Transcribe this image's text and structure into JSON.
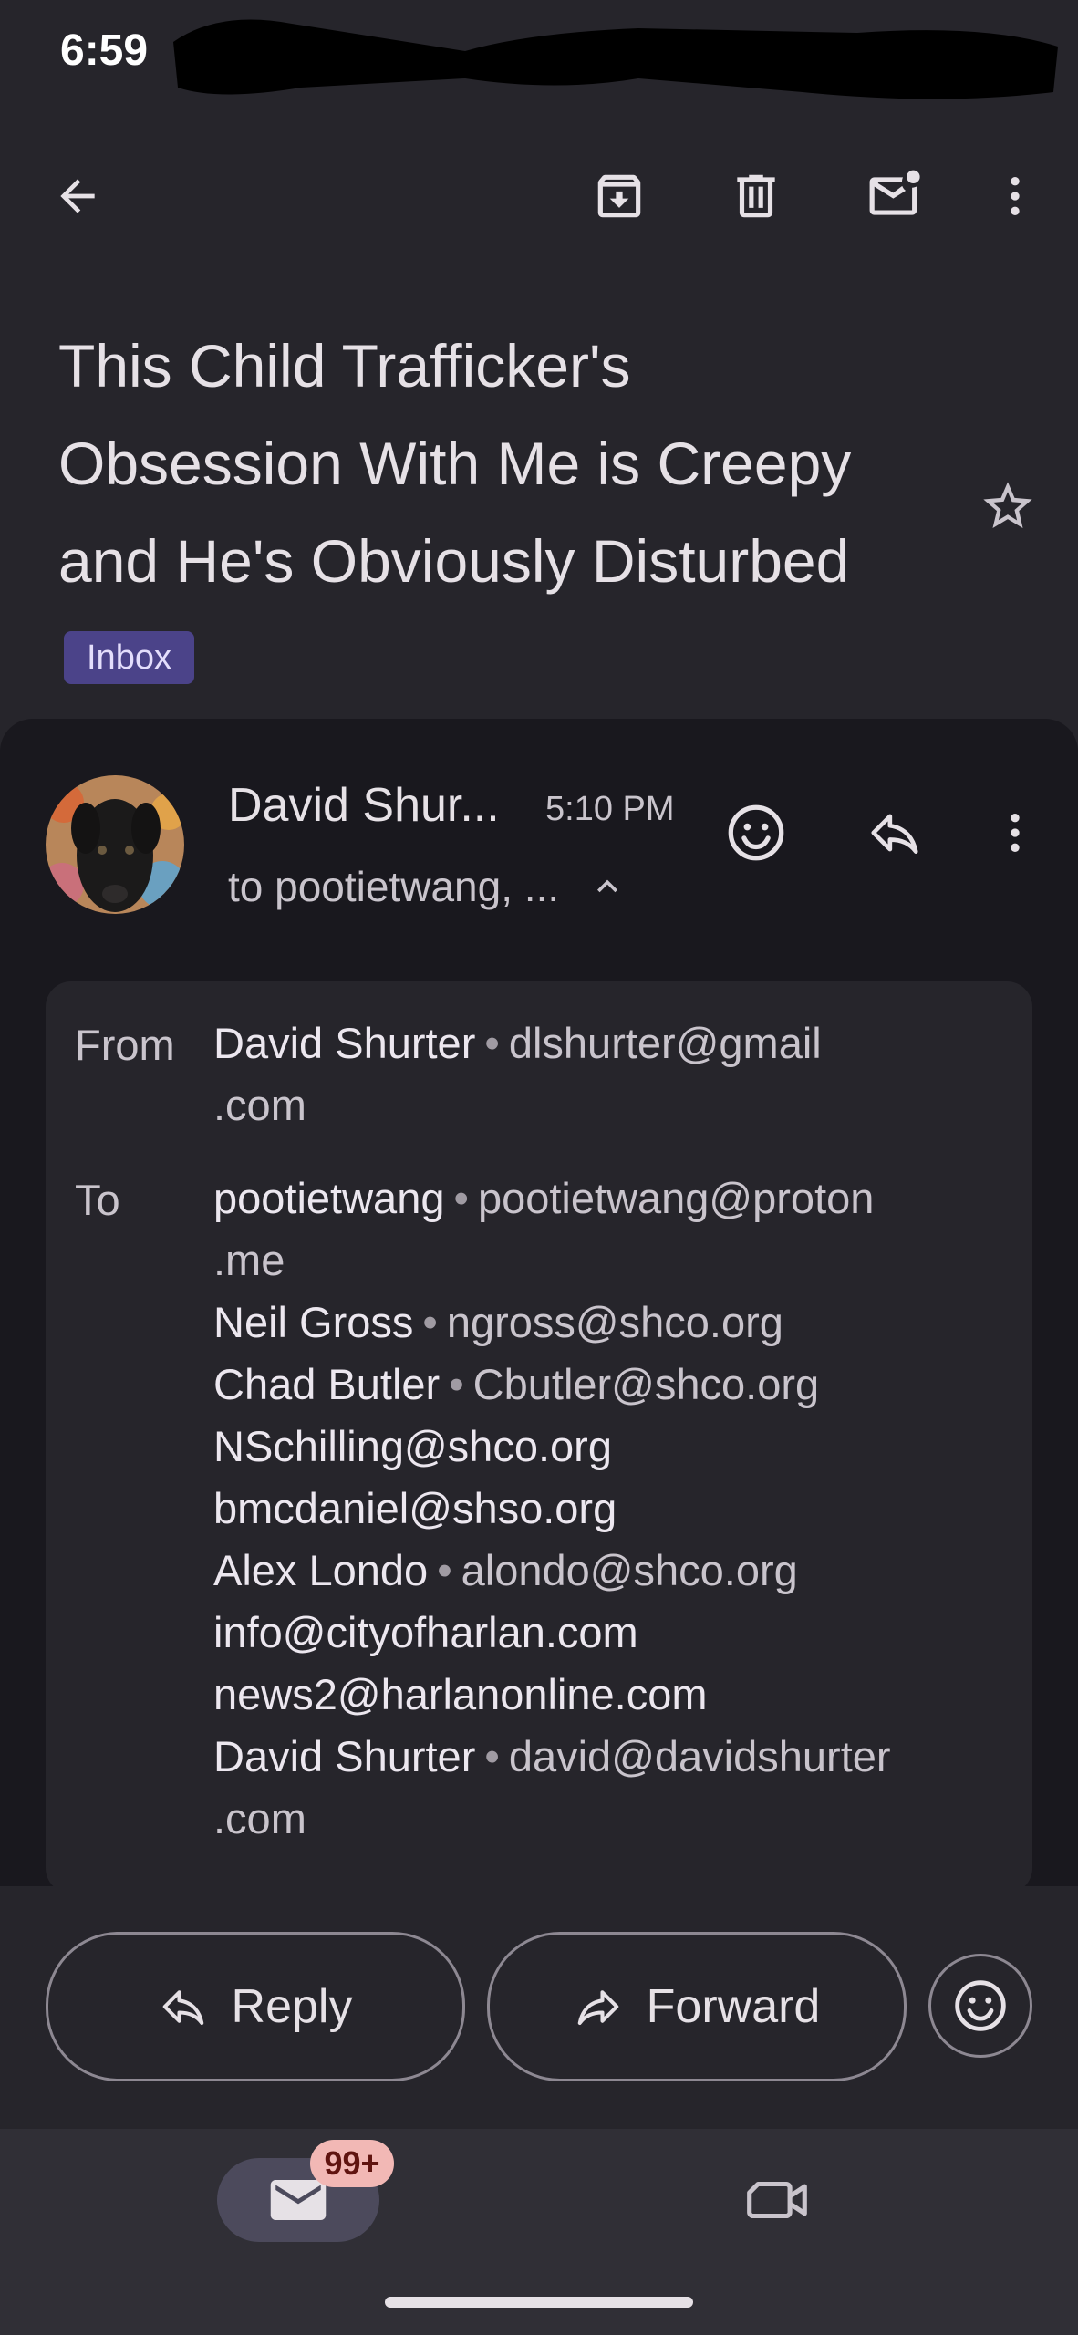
{
  "status_bar": {
    "time": "6:59"
  },
  "toolbar": {
    "back_icon": "arrow-back-icon",
    "archive_icon": "archive-icon",
    "delete_icon": "trash-icon",
    "mark_unread_icon": "mark-unread-icon",
    "more_icon": "more-vert-icon"
  },
  "email": {
    "subject": "This Child Trafficker's Obsession With Me is Creepy and He's Obviously Disturbed",
    "label": "Inbox",
    "starred": false
  },
  "message": {
    "sender_short": "David Shur...",
    "time": "5:10 PM",
    "to_summary": "to pootietwang, ...",
    "details": {
      "from_label": "From",
      "to_label": "To",
      "from": {
        "name": "David Shurter",
        "email_line1": "dlshurter@gmail",
        "email_line2": ".com"
      },
      "to": [
        {
          "name": "pootietwang",
          "email": "pootietwang@proton",
          "cont": ".me"
        },
        {
          "name": "Neil Gross",
          "email": "ngross@shco.org"
        },
        {
          "name": "Chad Butler",
          "email": "Cbutler@shco.org"
        },
        {
          "name": "",
          "email": "NSchilling@shco.org"
        },
        {
          "name": "",
          "email": "bmcdaniel@shso.org"
        },
        {
          "name": "Alex Londo",
          "email": "alondo@shco.org"
        },
        {
          "name": "",
          "email": "info@cityofharlan.com"
        },
        {
          "name": "",
          "email": "news2@harlanonline.com"
        },
        {
          "name": "David Shurter",
          "email": "david@davidshurter",
          "cont": ".com"
        }
      ]
    }
  },
  "actions": {
    "reply": "Reply",
    "forward": "Forward"
  },
  "bottom_nav": {
    "mail_badge": "99+"
  },
  "colors": {
    "background": "#26252b",
    "card": "#19181e",
    "chip": "#4b4389",
    "badge": "#f2b8b5"
  }
}
